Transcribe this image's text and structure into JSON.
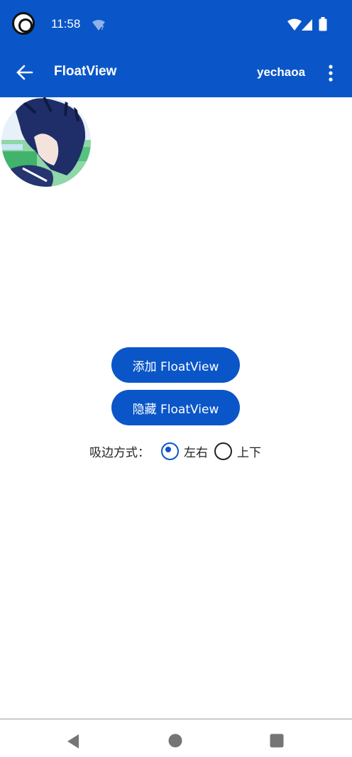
{
  "status_bar": {
    "time": "11:58",
    "icons": [
      "app-notification-icon",
      "wifi-question-icon",
      "wifi-icon",
      "signal-icon",
      "battery-icon"
    ]
  },
  "toolbar": {
    "title": "FloatView",
    "action_label": "yechaoa",
    "back_icon": "back-arrow-icon",
    "overflow_icon": "more-vert-icon"
  },
  "buttons": {
    "add_label": "添加 FloatView",
    "hide_label": "隐藏 FloatView"
  },
  "edge_mode": {
    "label": "吸边方式：",
    "options": [
      {
        "label": "左右",
        "checked": true
      },
      {
        "label": "上下",
        "checked": false
      }
    ]
  },
  "colors": {
    "primary": "#0a56c8",
    "background": "#ffffff"
  },
  "nav_bar": {
    "icons": [
      "back-triangle-icon",
      "home-circle-icon",
      "recents-square-icon"
    ]
  }
}
